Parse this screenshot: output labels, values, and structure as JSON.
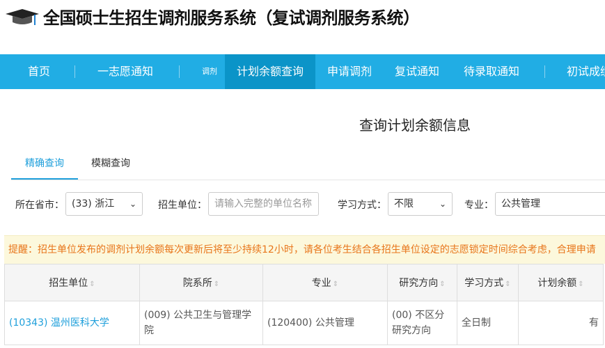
{
  "header": {
    "title": "全国硕士生招生调剂服务系统（复试调剂服务系统）"
  },
  "nav": {
    "items": [
      {
        "label": "首页"
      },
      {
        "label": "一志愿通知"
      },
      {
        "label": "调剂"
      },
      {
        "label": "计划余额查询",
        "active": true
      },
      {
        "label": "申请调剂"
      },
      {
        "label": "复试通知"
      },
      {
        "label": "待录取通知"
      },
      {
        "label": "初试成绩"
      }
    ]
  },
  "main": {
    "heading": "查询计划余额信息",
    "tabs": [
      {
        "label": "精确查询",
        "active": true
      },
      {
        "label": "模糊查询"
      }
    ],
    "filters": {
      "province_label": "所在省市：",
      "province_value": "(33) 浙江",
      "unit_label": "招生单位：",
      "unit_placeholder": "请输入完整的单位名称",
      "mode_label": "学习方式：",
      "mode_value": "不限",
      "major_label": "专业：",
      "major_value": "公共管理"
    },
    "notice": "提醒：招生单位发布的调剂计划余额每次更新后将至少持续12小时，请各位考生结合各招生单位设定的志愿锁定时间综合考虑，合理申请",
    "table": {
      "headers": [
        "招生单位",
        "院系所",
        "专业",
        "研究方向",
        "学习方式",
        "计划余额"
      ],
      "rows": [
        [
          "(10343) 温州医科大学",
          "(009) 公共卫生与管理学院",
          "(120400) 公共管理",
          "(00) 不区分研究方向",
          "全日制",
          "有"
        ]
      ]
    }
  },
  "colors": {
    "nav": "#21ade4",
    "nav_active": "#0b94c8",
    "accent": "#1e9fdb",
    "notice_text": "#e8751a",
    "notice_bg": "#fcf8dc"
  }
}
